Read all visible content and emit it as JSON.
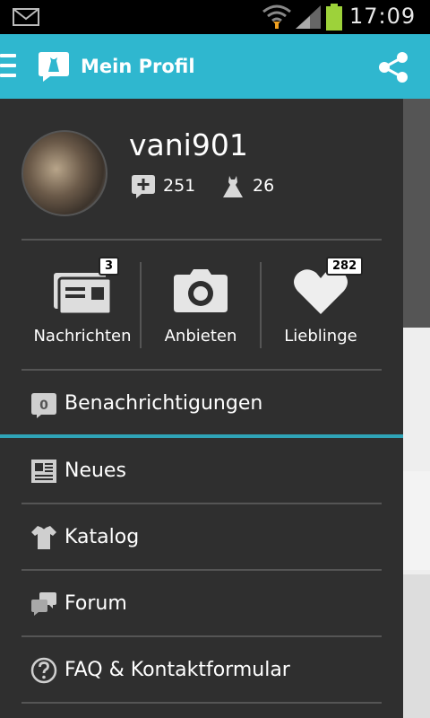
{
  "status_bar": {
    "time": "17:09"
  },
  "app_bar": {
    "title": "Mein Profil"
  },
  "profile": {
    "username": "vani901",
    "stats": [
      {
        "icon": "speech-plus-icon",
        "value": "251"
      },
      {
        "icon": "dress-icon",
        "value": "26"
      }
    ]
  },
  "quick_actions": [
    {
      "icon": "messages-icon",
      "label": "Nachrichten",
      "badge": "3"
    },
    {
      "icon": "camera-icon",
      "label": "Anbieten",
      "badge": ""
    },
    {
      "icon": "heart-icon",
      "label": "Lieblinge",
      "badge": "282"
    }
  ],
  "notifications": {
    "label": "Benachrichtigungen",
    "count": "0"
  },
  "menu": [
    {
      "icon": "newspaper-icon",
      "label": "Neues"
    },
    {
      "icon": "clothes-icon",
      "label": "Katalog"
    },
    {
      "icon": "chat-bubbles-icon",
      "label": "Forum"
    },
    {
      "icon": "question-icon",
      "label": "FAQ & Kontaktformular"
    }
  ],
  "colors": {
    "accent": "#2fb7cf",
    "drawer": "#2f2f2f",
    "divider": "#555555"
  }
}
